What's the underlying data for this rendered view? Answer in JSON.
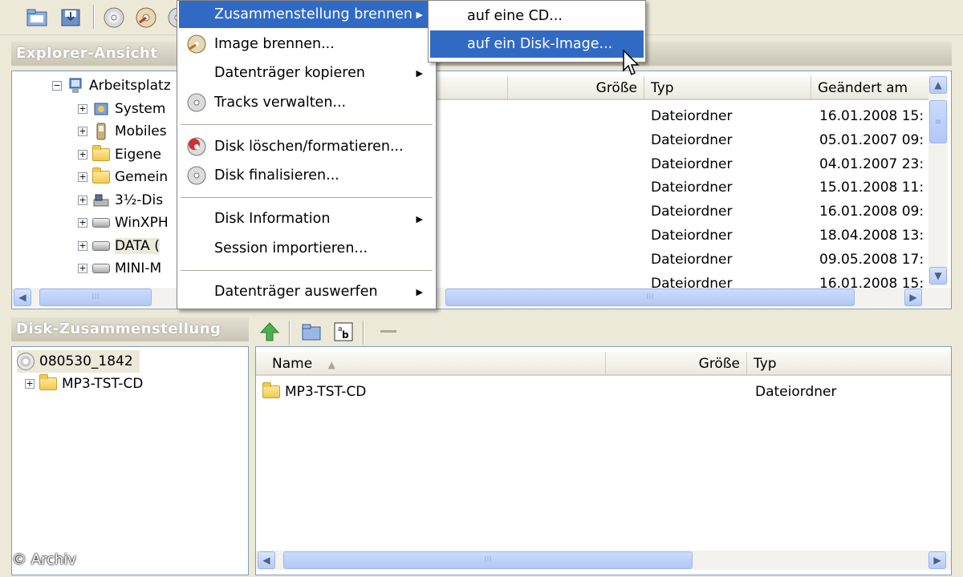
{
  "toolbar": {
    "icons": [
      "open-folder-icon",
      "save-icon",
      "disc-icon",
      "burn-icon"
    ]
  },
  "explorer": {
    "header": "Explorer-Ansicht",
    "tree": [
      {
        "label": "Arbeitsplatz",
        "icon": "computer-icon",
        "expander": "−"
      },
      {
        "label": "System",
        "icon": "control-panel-icon",
        "expander": "+"
      },
      {
        "label": "Mobiles",
        "icon": "mobile-device-icon",
        "expander": "+"
      },
      {
        "label": "Eigene",
        "icon": "folder-icon",
        "expander": "+"
      },
      {
        "label": "Gemein",
        "icon": "folder-icon",
        "expander": "+"
      },
      {
        "label": "3½-Dis",
        "icon": "floppy-icon",
        "expander": "+"
      },
      {
        "label": "WinXPH",
        "icon": "drive-icon",
        "expander": "+"
      },
      {
        "label": "DATA (",
        "icon": "drive-icon",
        "expander": "+"
      },
      {
        "label": "MINI-M",
        "icon": "drive-icon",
        "expander": "+"
      }
    ],
    "columns": {
      "size": "Größe",
      "type": "Typ",
      "modified": "Geändert am"
    },
    "rows": [
      {
        "type": "Dateiordner",
        "modified": "16.01.2008 15:"
      },
      {
        "type": "Dateiordner",
        "modified": "05.01.2007 09:"
      },
      {
        "type": "Dateiordner",
        "modified": "04.01.2007 23:"
      },
      {
        "type": "Dateiordner",
        "modified": "15.01.2008 11:"
      },
      {
        "type": "Dateiordner",
        "modified": "16.01.2008 09:"
      },
      {
        "type": "Dateiordner",
        "modified": "18.04.2008 13:"
      },
      {
        "type": "Dateiordner",
        "modified": "09.05.2008 17:"
      },
      {
        "type": "Dateiordner",
        "modified": "16.01.2008 15:"
      }
    ]
  },
  "compilation": {
    "header": "Disk-Zusammenstellung",
    "tree": [
      {
        "label": "080530_1842",
        "icon": "disc-icon"
      },
      {
        "label": "MP3-TST-CD",
        "icon": "folder-icon",
        "expander": "+"
      }
    ],
    "columns": {
      "name": "Name",
      "size": "Größe",
      "type": "Typ"
    },
    "rows": [
      {
        "name": "MP3-TST-CD",
        "type": "Dateiordner"
      }
    ]
  },
  "context_menu": {
    "items": [
      {
        "label": "Zusammenstellung brennen",
        "submenu": true,
        "highlighted": true
      },
      {
        "label": "Image brennen...",
        "icon": "burn-image-icon"
      },
      {
        "label": "Datenträger kopieren",
        "submenu": true
      },
      {
        "label": "Tracks verwalten...",
        "icon": "disc-icon"
      },
      {
        "label": "Disk löschen/formatieren...",
        "icon": "erase-disc-icon"
      },
      {
        "label": "Disk finalisieren...",
        "icon": "disc-icon"
      },
      {
        "label": "Disk Information",
        "submenu": true
      },
      {
        "label": "Session importieren..."
      },
      {
        "label": "Datenträger auswerfen",
        "submenu": true
      }
    ]
  },
  "submenu": {
    "items": [
      {
        "label": "auf eine CD..."
      },
      {
        "label": "auf ein Disk-Image...",
        "highlighted": true
      }
    ]
  },
  "watermark": "© Archiv",
  "colors": {
    "highlight": "#316ac5",
    "pane_border": "#7f9db9",
    "window_bg": "#ece9d8"
  }
}
